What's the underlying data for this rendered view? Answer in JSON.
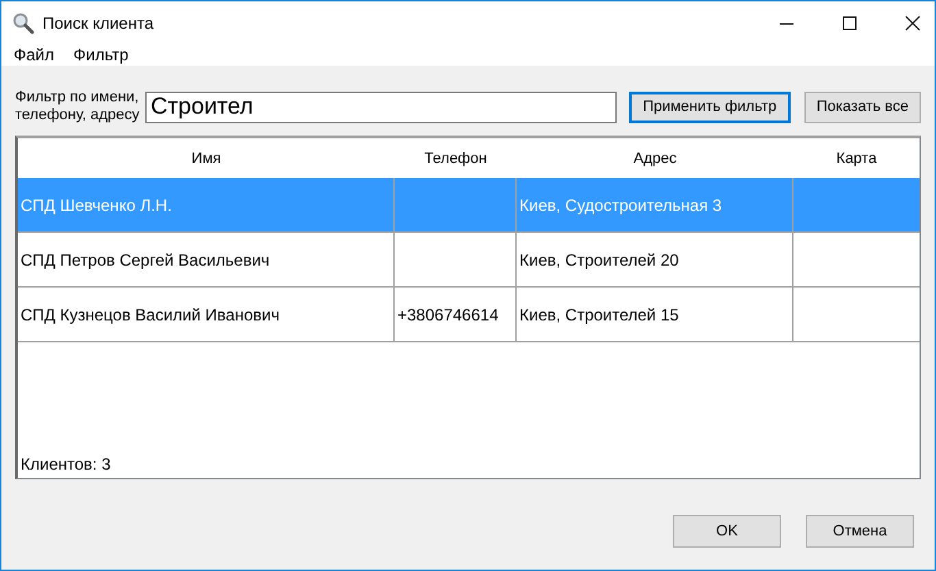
{
  "window": {
    "title": "Поиск клиента"
  },
  "menu": [
    "Файл",
    "Фильтр"
  ],
  "filter": {
    "label": "Фильтр по имени, телефону, адресу",
    "value": "Строител",
    "apply_button": "Применить фильтр",
    "show_all_button": "Показать все"
  },
  "table": {
    "columns": [
      "Имя",
      "Телефон",
      "Адрес",
      "Карта"
    ],
    "rows": [
      {
        "name": "СПД Шевченко Л.Н.",
        "phone": "",
        "address": "Киев, Судостроительная 3",
        "map": "",
        "selected": true
      },
      {
        "name": "СПД Петров Сергей Васильевич",
        "phone": "",
        "address": "Киев, Строителей 20",
        "map": "",
        "selected": false
      },
      {
        "name": "СПД Кузнецов Василий Иванович",
        "phone": "+3806746614",
        "address": "Киев, Строителей 15",
        "map": "",
        "selected": false
      }
    ],
    "footer": "Клиентов: 3"
  },
  "buttons": {
    "ok": "OK",
    "cancel": "Отмена"
  }
}
